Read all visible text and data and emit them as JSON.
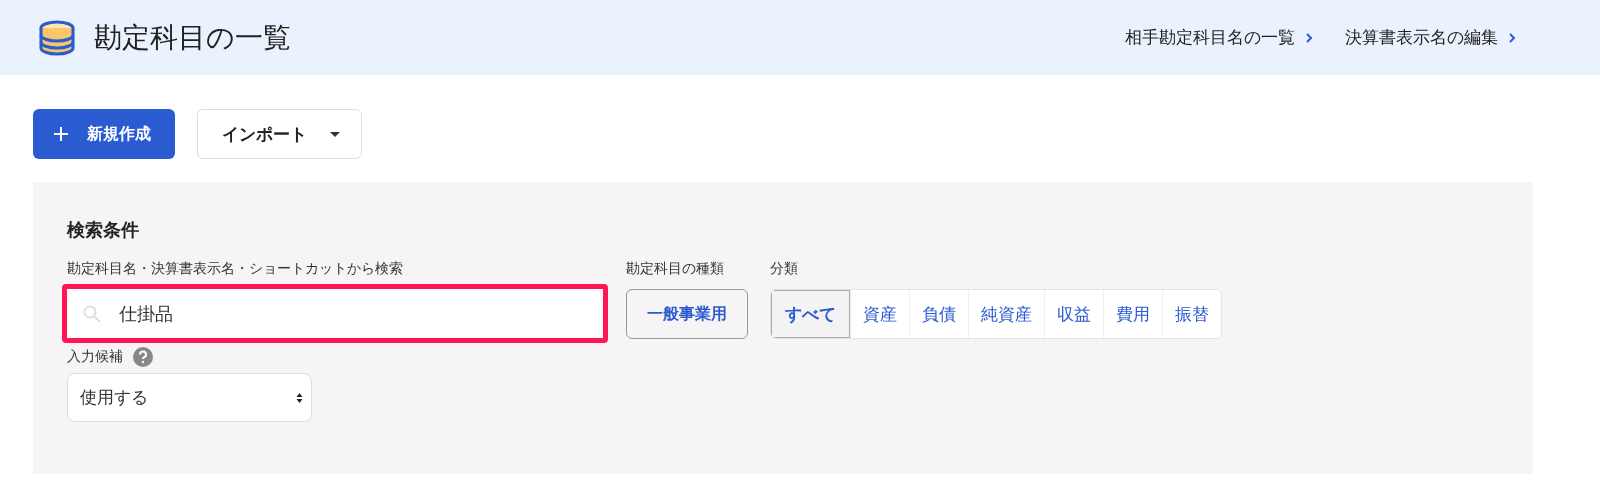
{
  "header": {
    "title": "勘定科目の一覧",
    "links": [
      {
        "label": "相手勘定科目名の一覧"
      },
      {
        "label": "決算書表示名の編集"
      }
    ]
  },
  "actions": {
    "create_button": "新規作成",
    "import_button": "インポート"
  },
  "search_panel": {
    "heading": "検索条件",
    "keyword": {
      "label": "勘定科目名・決算書表示名・ショートカットから検索",
      "value": "仕掛品",
      "highlighted": true
    },
    "account_type": {
      "label": "勘定科目の種類",
      "value": "一般事業用"
    },
    "category": {
      "label": "分類",
      "options": [
        {
          "label": "すべて",
          "selected": true
        },
        {
          "label": "資産",
          "selected": false
        },
        {
          "label": "負債",
          "selected": false
        },
        {
          "label": "純資産",
          "selected": false
        },
        {
          "label": "収益",
          "selected": false
        },
        {
          "label": "費用",
          "selected": false
        },
        {
          "label": "振替",
          "selected": false
        }
      ]
    },
    "suggest": {
      "label": "入力候補",
      "value": "使用する"
    }
  }
}
